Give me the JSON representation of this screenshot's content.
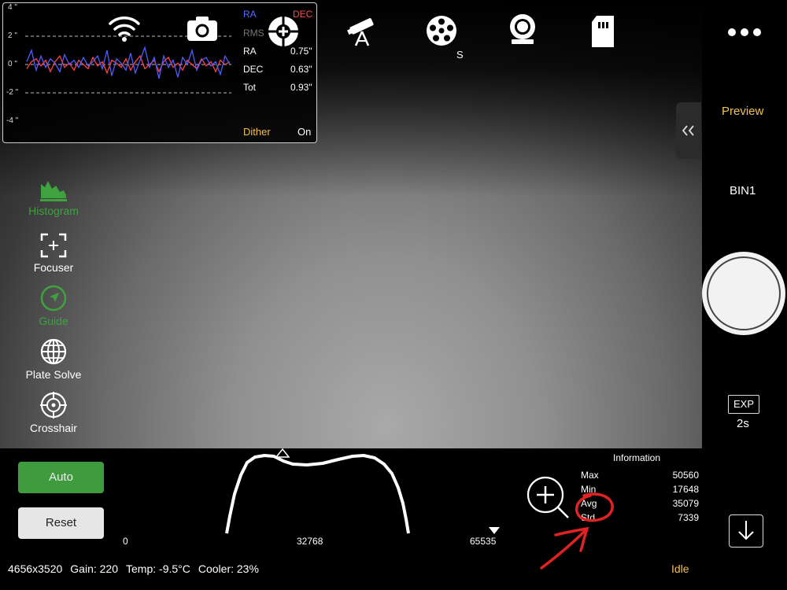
{
  "guide": {
    "y_ticks": [
      "4 \"",
      "2 \"",
      "0 \"",
      "-2 \"",
      "-4 \""
    ],
    "legend_ra": "RA",
    "legend_dec": "DEC",
    "rms_label": "RMS",
    "rows": [
      {
        "label": "RA",
        "value": "0.75\""
      },
      {
        "label": "DEC",
        "value": "0.63\""
      },
      {
        "label": "Tot",
        "value": "0.93\""
      }
    ],
    "dither_label": "Dither",
    "dither_value": "On",
    "colors": {
      "ra": "#4f5cff",
      "dec": "#ff4040"
    },
    "ra_values": [
      0.2,
      1.0,
      -0.4,
      0.6,
      -0.2,
      0.4,
      0.1,
      -0.5,
      0.7,
      0.0,
      0.3,
      -0.2,
      0.5,
      -0.1,
      0.2,
      0.6,
      -0.3,
      1.0,
      -0.8,
      0.4,
      0.1,
      -0.4,
      0.8,
      -0.6,
      0.3,
      1.2,
      -0.2,
      0.5,
      -1.0,
      0.6,
      -0.2,
      0.3,
      -0.9,
      0.5,
      0.0,
      1.0,
      -0.4,
      0.3,
      0.5,
      -0.1,
      0.2,
      -0.7,
      0.6,
      0.0
    ],
    "dec_values": [
      -0.3,
      0.2,
      0.4,
      -0.1,
      0.3,
      -0.5,
      0.2,
      0.6,
      -0.2,
      0.1,
      -0.4,
      0.3,
      0.0,
      -0.3,
      0.5,
      -0.1,
      0.2,
      -0.6,
      0.3,
      0.1,
      -0.2,
      0.4,
      -0.4,
      0.2,
      0.6,
      -0.3,
      0.0,
      0.3,
      -0.5,
      0.2,
      0.5,
      -0.2,
      0.1,
      -0.4,
      0.3,
      0.0,
      -0.3,
      0.4,
      -0.1,
      0.2,
      -0.5,
      0.3,
      0.0,
      0.2
    ]
  },
  "toolbar": {
    "filter_wheel_label": "S"
  },
  "sidebar": {
    "items": [
      {
        "label": "Histogram"
      },
      {
        "label": "Focuser"
      },
      {
        "label": "Guide"
      },
      {
        "label": "Plate Solve"
      },
      {
        "label": "Crosshair"
      }
    ]
  },
  "right": {
    "preview_label": "Preview",
    "bin_label": "BIN1",
    "exp_badge": "EXP",
    "exp_value": "2s",
    "collapse_icon": "double-chevron-left-icon"
  },
  "histogram": {
    "auto_label": "Auto",
    "reset_label": "Reset",
    "axis_min": "0",
    "axis_mid": "32768",
    "axis_max": "65535",
    "accent_green": "#3e9b3e"
  },
  "info": {
    "title": "Information",
    "rows": [
      {
        "label": "Max",
        "value": "50560"
      },
      {
        "label": "Min",
        "value": "17648"
      },
      {
        "label": "Avg",
        "value": "35079"
      },
      {
        "label": "Std",
        "value": "7339"
      }
    ]
  },
  "status": {
    "resolution": "4656x3520",
    "gain": "Gain: 220",
    "temp": "Temp: -9.5°C",
    "cooler": "Cooler: 23%",
    "state": "Idle"
  }
}
